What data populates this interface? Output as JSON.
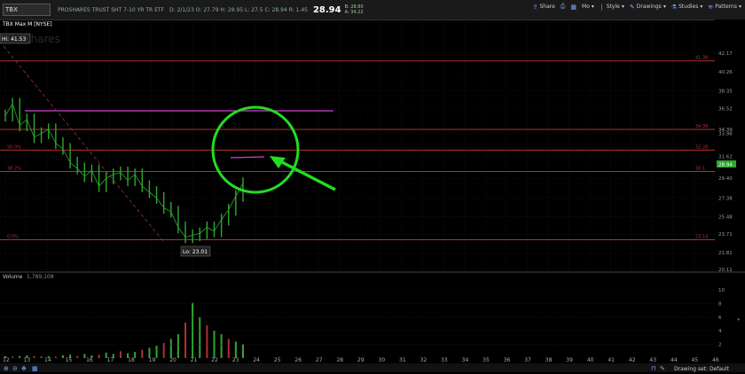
{
  "header": {
    "symbol": "TBX",
    "description": "PROSHARES TRUST SHT 7-10 YR TR ETF",
    "quote": "D: 2/1/23   O: 27.79   H: 28.95   L: 27.5   C: 28.94   R: 1.45",
    "last": "28.94",
    "bid": "B: 28.80",
    "ask": "A: 34.22"
  },
  "toolbar": {
    "share": "Share",
    "mo": "Mo",
    "style": "Style",
    "drawings": "Drawings",
    "studies": "Studies",
    "patterns": "Patterns"
  },
  "chart": {
    "label": "TBX Max M [NYSE]",
    "watermark": "ProShares",
    "high_label": "Hi: 41.53",
    "low_label": "Lo: 23.01",
    "current_price": "28.94",
    "y_ticks": [
      "42.17",
      "40.26",
      "38.35",
      "36.52",
      "34.39",
      "33.98",
      "31.62",
      "29.40",
      "27.38",
      "25.48",
      "23.71",
      "21.81",
      "20.11"
    ],
    "fib_levels": [
      {
        "price": "41.38",
        "pct": ""
      },
      {
        "price": "34.39",
        "pct": ""
      },
      {
        "price": "32.28",
        "pct": "50.0%"
      },
      {
        "price": "30.1",
        "pct": "38.2%"
      },
      {
        "price": "23.14",
        "pct": "0.0%"
      }
    ],
    "x_ticks": [
      "12",
      "13",
      "14",
      "15",
      "16",
      "17",
      "18",
      "19",
      "20",
      "21",
      "22",
      "23",
      "24",
      "25",
      "26",
      "27",
      "28",
      "29",
      "30",
      "31",
      "32",
      "33",
      "34",
      "35",
      "36",
      "37",
      "38",
      "39",
      "40",
      "41",
      "42",
      "43",
      "44",
      "45",
      "46"
    ],
    "price_series": [
      35.8,
      37.0,
      34.8,
      35.4,
      33.6,
      34.0,
      34.4,
      33.0,
      32.4,
      31.0,
      30.4,
      29.6,
      30.2,
      28.6,
      29.4,
      29.8,
      30.0,
      29.2,
      29.8,
      28.6,
      28.0,
      27.4,
      26.4,
      26.0,
      24.4,
      23.4,
      23.6,
      23.8,
      24.4,
      24.0,
      25.2,
      26.2,
      27.6,
      28.9
    ]
  },
  "volume": {
    "label": "Volume",
    "value": "1,789,108",
    "ticks": [
      "10",
      "8",
      "6",
      "4",
      "2"
    ],
    "bars": [
      0.3,
      0.2,
      0.3,
      0.4,
      0.3,
      0.2,
      0.3,
      0.2,
      0.4,
      0.5,
      0.3,
      0.6,
      0.4,
      0.5,
      0.8,
      0.6,
      1.0,
      0.7,
      0.9,
      1.2,
      1.5,
      1.8,
      2.2,
      2.8,
      3.5,
      5.2,
      8.1,
      6.0,
      4.8,
      4.0,
      3.5,
      2.8,
      2.4,
      2.0
    ]
  },
  "footer": {
    "drawing_set": "Drawing set: Default"
  },
  "colors": {
    "fib": "#b03030",
    "magenta": "#d040d0",
    "annotation": "#22dd22",
    "price": "#2ea82e",
    "trend": "#a03030"
  }
}
